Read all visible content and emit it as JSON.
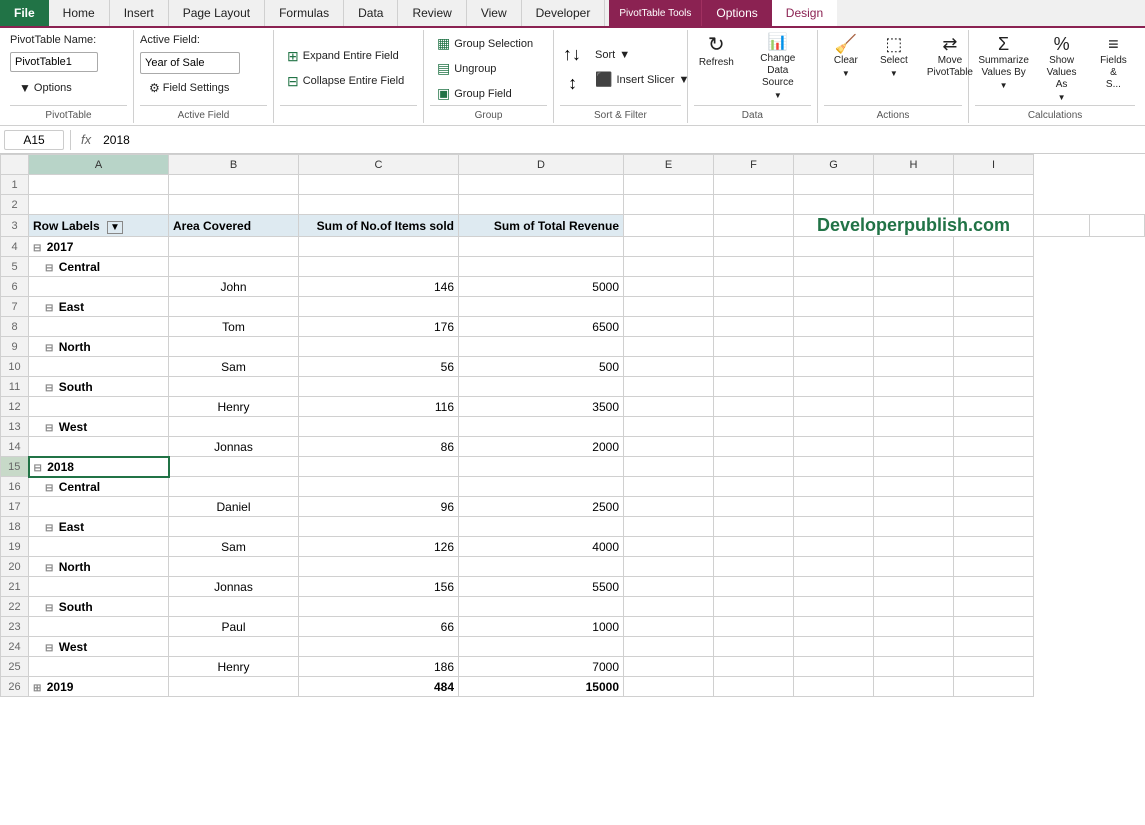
{
  "tabs": {
    "file": "File",
    "home": "Home",
    "insert": "Insert",
    "page_layout": "Page Layout",
    "formulas": "Formulas",
    "data": "Data",
    "review": "Review",
    "view": "View",
    "developer": "Developer",
    "options": "Options",
    "design": "Design"
  },
  "context_group": "PivotTable Tools",
  "ribbon": {
    "pivottable_section": "PivotTable",
    "pivottable_name_label": "PivotTable Name:",
    "pivottable_name_value": "PivotTable1",
    "options_btn": "Options",
    "active_field_section": "Active Field",
    "active_field_label": "Active Field:",
    "active_field_value": "Year of Sale",
    "field_settings_btn": "Field Settings",
    "expand_entire_field": "Expand Entire Field",
    "collapse_entire_field": "Collapse Entire Field",
    "group_selection": "Group Selection",
    "ungroup": "Ungroup",
    "group_field": "Group Field",
    "sort_section": "Sort & Filter",
    "sort_asc": "Sort A to Z",
    "sort_desc": "Sort Z to A",
    "sort_btn": "Sort",
    "insert_slicer": "Insert Slicer",
    "data_section": "Data",
    "refresh": "Refresh",
    "change_data_source": "Change Data Source",
    "source": "Source",
    "actions_section": "Actions",
    "clear": "Clear",
    "select": "Select",
    "move_pivottable": "Move PivotTable",
    "calculations_section": "Calculations",
    "summarize_values_by": "Summarize Values By",
    "show_values_as": "Show Values As",
    "fields_label": "Fields &"
  },
  "formula_bar": {
    "cell_ref": "A15",
    "formula": "2018"
  },
  "columns": [
    "A",
    "B",
    "C",
    "D",
    "E",
    "F",
    "G",
    "H",
    "I"
  ],
  "headers": {
    "row_labels": "Row Labels",
    "area_covered": "Area Covered",
    "sum_items": "Sum of No.of Items sold",
    "sum_revenue": "Sum of Total Revenue"
  },
  "brand": "Developerpublish.com",
  "data": {
    "rows": [
      {
        "row": 1,
        "type": "empty"
      },
      {
        "row": 2,
        "type": "empty"
      },
      {
        "row": 3,
        "type": "headers"
      },
      {
        "row": 4,
        "type": "year",
        "year": "2017",
        "collapsed": false
      },
      {
        "row": 5,
        "type": "area",
        "area": "Central",
        "collapsed": false
      },
      {
        "row": 6,
        "type": "data",
        "person": "John",
        "items": "146",
        "revenue": "5000"
      },
      {
        "row": 7,
        "type": "area",
        "area": "East",
        "collapsed": false
      },
      {
        "row": 8,
        "type": "data",
        "person": "Tom",
        "items": "176",
        "revenue": "6500"
      },
      {
        "row": 9,
        "type": "area",
        "area": "North",
        "collapsed": false
      },
      {
        "row": 10,
        "type": "data",
        "person": "Sam",
        "items": "56",
        "revenue": "500"
      },
      {
        "row": 11,
        "type": "area",
        "area": "South",
        "collapsed": false
      },
      {
        "row": 12,
        "type": "data",
        "person": "Henry",
        "items": "116",
        "revenue": "3500"
      },
      {
        "row": 13,
        "type": "area",
        "area": "West",
        "collapsed": false
      },
      {
        "row": 14,
        "type": "data",
        "person": "Jonnas",
        "items": "86",
        "revenue": "2000"
      },
      {
        "row": 15,
        "type": "year",
        "year": "2018",
        "collapsed": false,
        "selected": true
      },
      {
        "row": 16,
        "type": "area",
        "area": "Central",
        "collapsed": false
      },
      {
        "row": 17,
        "type": "data",
        "person": "Daniel",
        "items": "96",
        "revenue": "2500"
      },
      {
        "row": 18,
        "type": "area",
        "area": "East",
        "collapsed": false
      },
      {
        "row": 19,
        "type": "data",
        "person": "Sam",
        "items": "126",
        "revenue": "4000"
      },
      {
        "row": 20,
        "type": "area",
        "area": "North",
        "collapsed": false
      },
      {
        "row": 21,
        "type": "data",
        "person": "Jonnas",
        "items": "156",
        "revenue": "5500"
      },
      {
        "row": 22,
        "type": "area",
        "area": "South",
        "collapsed": false
      },
      {
        "row": 23,
        "type": "data",
        "person": "Paul",
        "items": "66",
        "revenue": "1000"
      },
      {
        "row": 24,
        "type": "area",
        "area": "West",
        "collapsed": false
      },
      {
        "row": 25,
        "type": "data",
        "person": "Henry",
        "items": "186",
        "revenue": "7000"
      },
      {
        "row": 26,
        "type": "year",
        "year": "2019",
        "collapsed": true,
        "items_bold": "484",
        "revenue_bold": "15000"
      }
    ]
  }
}
